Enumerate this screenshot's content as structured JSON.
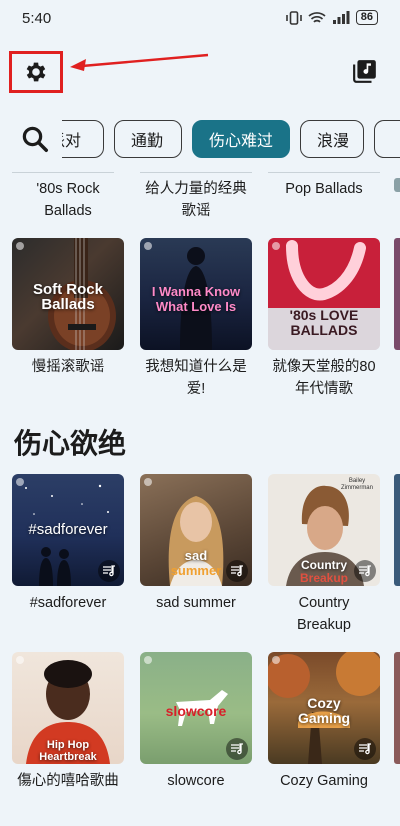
{
  "status_bar": {
    "time": "5:40",
    "battery": "86"
  },
  "filters": {
    "chips": [
      {
        "label": "派对",
        "active": false
      },
      {
        "label": "通勤",
        "active": false
      },
      {
        "label": "伤心难过",
        "active": true
      },
      {
        "label": "浪漫",
        "active": false
      },
      {
        "label": "",
        "active": false
      }
    ]
  },
  "top_row_captions": [
    "'80s Rock Ballads",
    "给人力量的经典歌谣",
    "Pop Ballads"
  ],
  "row1": [
    {
      "tile_text": "Soft Rock Ballads",
      "caption": "慢摇滚歌谣"
    },
    {
      "tile_text": "I Wanna Know What Love Is",
      "caption": "我想知道什么是爱!"
    },
    {
      "tile_text": "'80s LOVE BALLADS",
      "caption": "就像天堂般的80年代情歌"
    }
  ],
  "section": {
    "title": "伤心欲绝"
  },
  "row2": [
    {
      "tile_text": "#sadforever",
      "caption": "#sadforever"
    },
    {
      "tile_text_top": "sad",
      "tile_text_bottom": "summer",
      "caption": "sad summer"
    },
    {
      "tile_text_top": "Country",
      "tile_text_bottom": "Breakup",
      "tile_corner": "Bailey Zimmerman",
      "caption": "Country Breakup"
    }
  ],
  "row3": [
    {
      "tile_text_top": "Hip Hop",
      "tile_text_bottom": "Heartbreak",
      "caption": "傷心的嘻哈歌曲"
    },
    {
      "tile_text": "slowcore",
      "caption": "slowcore"
    },
    {
      "tile_text": "Cozy Gaming",
      "caption": "Cozy Gaming"
    }
  ],
  "colors": {
    "accent": "#1a7388",
    "annotation": "#e02020",
    "background": "#eef4f9"
  }
}
